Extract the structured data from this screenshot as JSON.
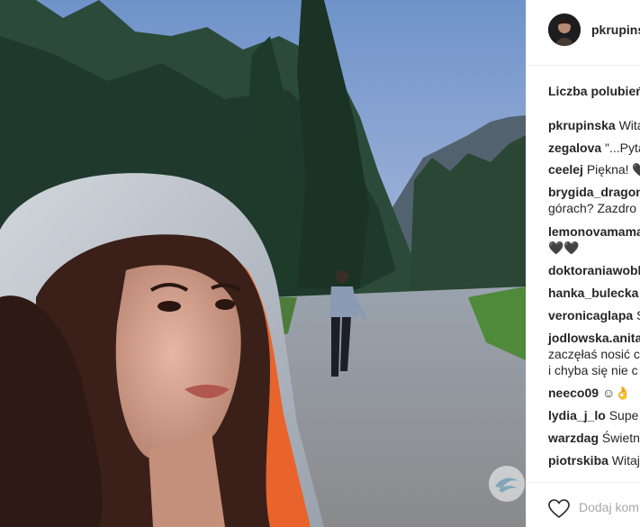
{
  "post": {
    "username": "pkrupinsk",
    "likes_label": "Liczba polubień",
    "add_comment_placeholder": "Dodaj kom"
  },
  "comments": [
    {
      "user": "pkrupinska",
      "text": "Wita"
    },
    {
      "user": "zegalova",
      "text": "\"...Pyta"
    },
    {
      "user": "ceelej",
      "text": "Piękna! 🖤"
    },
    {
      "user": "brygida_dragon",
      "text": ""
    },
    {
      "user": "",
      "text": "górach? Zazdro"
    },
    {
      "user": "lemonovamama",
      "text": ""
    },
    {
      "user": "",
      "text": "🖤🖤"
    },
    {
      "user": "doktoraniawobl",
      "text": ""
    },
    {
      "user": "hanka_bulecka",
      "text": ""
    },
    {
      "user": "veronicaglapa",
      "text": "S"
    },
    {
      "user": "jodlowska.anita",
      "text": ""
    },
    {
      "user": "",
      "text": "zaczęłaś nosić c"
    },
    {
      "user": "",
      "text": "i chyba się nie c"
    },
    {
      "user": "neeco09",
      "text": "☺👌"
    },
    {
      "user": "lydia_j_lo",
      "text": "Supe"
    },
    {
      "user": "warzdag",
      "text": "Świetn"
    },
    {
      "user": "piotrskiba",
      "text": "Witaj"
    }
  ],
  "icons": {
    "heart": "heart-icon",
    "watermark": "watermark-logo"
  },
  "colors": {
    "border": "#efefef",
    "text": "#262626",
    "muted": "#a8a8a8"
  }
}
